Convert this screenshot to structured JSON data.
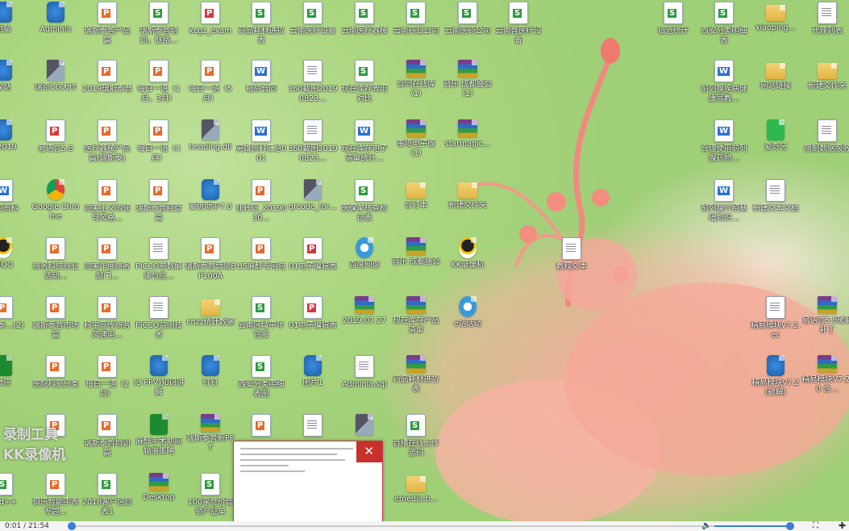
{
  "icons": [
    {
      "id": "i1",
      "type": "app",
      "label": "电脑",
      "col": 0,
      "row": 0
    },
    {
      "id": "i2",
      "type": "app",
      "label": "Adminla",
      "col": 1,
      "row": 0
    },
    {
      "id": "i3",
      "type": "ppt",
      "label": "瑞斯泰普产品篇",
      "col": 2,
      "row": 0
    },
    {
      "id": "i4",
      "type": "xls",
      "label": "瑞斯泰普培训，联络…",
      "col": 3,
      "row": 0
    },
    {
      "id": "i5",
      "type": "pdf",
      "label": "kcgz_exam",
      "col": 4,
      "row": 0
    },
    {
      "id": "i6",
      "type": "xls",
      "label": "药品耗材进货表",
      "col": 5,
      "row": 0
    },
    {
      "id": "i7",
      "type": "xls",
      "label": "云南医疗设备",
      "col": 6,
      "row": 0
    },
    {
      "id": "i8",
      "type": "xls",
      "label": "云南医疗器械",
      "col": 7,
      "row": 0
    },
    {
      "id": "i9",
      "type": "xls",
      "label": "云南药业公司",
      "col": 8,
      "row": 0
    },
    {
      "id": "i10",
      "type": "xls",
      "label": "云南医药公司",
      "col": 9,
      "row": 0
    },
    {
      "id": "i11",
      "type": "xls",
      "label": "云南普医疗设备",
      "col": 10,
      "row": 0
    },
    {
      "id": "i12",
      "type": "xls",
      "label": "临沧统计",
      "col": 13,
      "row": 0
    },
    {
      "id": "i13",
      "type": "xls",
      "label": "西安分类明细表",
      "col": 14,
      "row": 0
    },
    {
      "id": "i14",
      "type": "folder",
      "label": "xiaoping…",
      "col": 15,
      "row": 0
    },
    {
      "id": "i15",
      "type": "txt",
      "label": "代理列表",
      "col": 16,
      "row": 0
    },
    {
      "id": "i16",
      "type": "app",
      "label": "收站",
      "col": 0,
      "row": 1
    },
    {
      "id": "i17",
      "type": "img",
      "label": "瑞奇CG大作",
      "col": 1,
      "row": 1
    },
    {
      "id": "i18",
      "type": "ppt",
      "label": "2019瑞斯泰普",
      "col": 2,
      "row": 1
    },
    {
      "id": "i19",
      "type": "ppt",
      "label": "每日一语（1月，3月）",
      "col": 3,
      "row": 1
    },
    {
      "id": "i20",
      "type": "ppt",
      "label": "每日一语（5月）",
      "col": 4,
      "row": 1
    },
    {
      "id": "i21",
      "type": "doc",
      "label": "租房合同",
      "col": 5,
      "row": 1
    },
    {
      "id": "i22",
      "type": "txt",
      "label": "360截图20190823…",
      "col": 6,
      "row": 1
    },
    {
      "id": "i23",
      "type": "xls",
      "label": "现在库存表用对比",
      "col": 7,
      "row": 1
    },
    {
      "id": "i24",
      "type": "rar",
      "label": "合同在线库（1）",
      "col": 8,
      "row": 1
    },
    {
      "id": "i25",
      "type": "rar",
      "label": "音乐 成都盛会（1）",
      "col": 9,
      "row": 1
    },
    {
      "id": "i26",
      "type": "doc",
      "label": "前列腺疾病健康宣教…",
      "col": 14,
      "row": 1
    },
    {
      "id": "i27",
      "type": "folder",
      "label": "网站链接",
      "col": 15,
      "row": 1
    },
    {
      "id": "i28",
      "type": "folder",
      "label": "新建文件夹",
      "col": 16,
      "row": 1
    },
    {
      "id": "i29",
      "type": "app",
      "label": "S 2019",
      "col": 0,
      "row": 2
    },
    {
      "id": "i30",
      "type": "pdf",
      "label": "易语言5.8",
      "col": 1,
      "row": 2
    },
    {
      "id": "i31",
      "type": "ppt",
      "label": "医疗器械产品篇(瑞斯泰)",
      "col": 2,
      "row": 2
    },
    {
      "id": "i32",
      "type": "ppt",
      "label": "每日一语（4月）",
      "col": 3,
      "row": 2
    },
    {
      "id": "i33",
      "type": "img",
      "label": "heading.dll",
      "col": 4,
      "row": 2
    },
    {
      "id": "i34",
      "type": "doc",
      "label": "英雄资料汇总001",
      "col": 5,
      "row": 2
    },
    {
      "id": "i35",
      "type": "txt",
      "label": "360截图20190823…",
      "col": 6,
      "row": 2
    },
    {
      "id": "i36",
      "type": "doc",
      "label": "现在库存电子清单统计…",
      "col": 7,
      "row": 2
    },
    {
      "id": "i37",
      "type": "rar",
      "label": "事项电子版（1）",
      "col": 8,
      "row": 2
    },
    {
      "id": "i38",
      "type": "rar",
      "label": "starmagic…",
      "col": 9,
      "row": 2
    },
    {
      "id": "i39",
      "type": "doc",
      "label": "合理使用前列腺药物…",
      "col": 14,
      "row": 2
    },
    {
      "id": "i40",
      "type": "iqiyi",
      "label": "爱奇艺",
      "col": 15,
      "row": 2
    },
    {
      "id": "i41",
      "type": "txt",
      "label": "限制数据服务",
      "col": 16,
      "row": 2
    },
    {
      "id": "i42",
      "type": "doc",
      "label": "学习资料",
      "col": 0,
      "row": 3
    },
    {
      "id": "i43",
      "type": "chrome",
      "label": "Google Chrome",
      "col": 1,
      "row": 3
    },
    {
      "id": "i44",
      "type": "ppt",
      "label": "完美主义的领导风格…",
      "col": 2,
      "row": 3
    },
    {
      "id": "i45",
      "type": "ppt",
      "label": "瑞斯泰普经营篇",
      "col": 3,
      "row": 3
    },
    {
      "id": "i46",
      "type": "app",
      "label": "爱思助手7.0",
      "col": 4,
      "row": 3
    },
    {
      "id": "i47",
      "type": "ppt",
      "label": "住转证_2019030…",
      "col": 5,
      "row": 3
    },
    {
      "id": "i48",
      "type": "img",
      "label": "qrcode_for…",
      "col": 6,
      "row": 3
    },
    {
      "id": "i49",
      "type": "xls",
      "label": "医保单核查检证表",
      "col": 7,
      "row": 3
    },
    {
      "id": "i50",
      "type": "folder",
      "label": "合订本",
      "col": 8,
      "row": 3
    },
    {
      "id": "i51",
      "type": "folder",
      "label": "新建文件夹",
      "col": 9,
      "row": 3
    },
    {
      "id": "i52",
      "type": "doc",
      "label": "前列腺介绍基础知识…",
      "col": 14,
      "row": 3
    },
    {
      "id": "i53",
      "type": "txt",
      "label": "新建文本文档",
      "col": 15,
      "row": 3
    },
    {
      "id": "i54",
      "type": "qq",
      "label": "讯QQ",
      "col": 0,
      "row": 4
    },
    {
      "id": "i55",
      "type": "ppt",
      "label": "商务科技商业活动…",
      "col": 1,
      "row": 4
    },
    {
      "id": "i56",
      "type": "ppt",
      "label": "完美年度商务部门…",
      "col": 2,
      "row": 4
    },
    {
      "id": "i57",
      "type": "txt",
      "label": "PICCO参数解读与应…",
      "col": 3,
      "row": 4
    },
    {
      "id": "i58",
      "type": "ppt",
      "label": "瑞斯泰普营销BP100A",
      "col": 4,
      "row": 4
    },
    {
      "id": "i59",
      "type": "ppt",
      "label": "U5麻醉专用包",
      "col": 5,
      "row": 4
    },
    {
      "id": "i60",
      "type": "pdf",
      "label": "01电子编辑表",
      "col": 6,
      "row": 4
    },
    {
      "id": "i61",
      "type": "web",
      "label": "百度网盘",
      "col": 7,
      "row": 4
    },
    {
      "id": "i62",
      "type": "rar",
      "label": "音乐 成都盛会",
      "col": 8,
      "row": 4
    },
    {
      "id": "i63",
      "type": "qq",
      "label": "KK录像机",
      "col": 9,
      "row": 4
    },
    {
      "id": "i64",
      "type": "ppt",
      "label": "瑞斯泰…(2)",
      "col": 0,
      "row": 5
    },
    {
      "id": "i65",
      "type": "ppt",
      "label": "瑞斯泰普市场篇",
      "col": 1,
      "row": 5
    },
    {
      "id": "i66",
      "type": "ppt",
      "label": "穆宝蕊传商务风通用…",
      "col": 2,
      "row": 5
    },
    {
      "id": "i67",
      "type": "txt",
      "label": "PICCO监测技术",
      "col": 3,
      "row": 5
    },
    {
      "id": "i68",
      "type": "folder",
      "label": "cnzz统计数据",
      "col": 4,
      "row": 5
    },
    {
      "id": "i69",
      "type": "xls",
      "label": "云南区域平年官报",
      "col": 5,
      "row": 5
    },
    {
      "id": "i70",
      "type": "pdf",
      "label": "01电子编辑表",
      "col": 6,
      "row": 5
    },
    {
      "id": "i71",
      "type": "rar",
      "label": "2019.07.27",
      "col": 7,
      "row": 5
    },
    {
      "id": "i72",
      "type": "rar",
      "label": "现在库存产品清单",
      "col": 8,
      "row": 5
    },
    {
      "id": "i73",
      "type": "web",
      "label": "e站活动",
      "col": 9,
      "row": 5
    },
    {
      "id": "i74",
      "type": "txt",
      "label": "精易模块v7.2.ec",
      "col": 15,
      "row": 5
    },
    {
      "id": "i75",
      "type": "rar",
      "label": "易语言5.8破解补丁",
      "col": 16,
      "row": 5
    },
    {
      "id": "i76",
      "type": "green",
      "label": "微信",
      "col": 0,
      "row": 6
    },
    {
      "id": "i77",
      "type": "ppt",
      "label": "医院科室分类",
      "col": 1,
      "row": 6
    },
    {
      "id": "i78",
      "type": "ppt",
      "label": "每日一语（2月）",
      "col": 2,
      "row": 6
    },
    {
      "id": "i79",
      "type": "app",
      "label": "(3 PPV)知识讲解",
      "col": 3,
      "row": 6
    },
    {
      "id": "i80",
      "type": "app",
      "label": "钉钉",
      "col": 4,
      "row": 6
    },
    {
      "id": "i81",
      "type": "xls",
      "label": "西安分类明细表图",
      "col": 5,
      "row": 6
    },
    {
      "id": "i82",
      "type": "app",
      "label": "图片1",
      "col": 6,
      "row": 6
    },
    {
      "id": "i83",
      "type": "txt",
      "label": "Adminla.sql",
      "col": 7,
      "row": 6
    },
    {
      "id": "i84",
      "type": "rar",
      "label": "药品耗材进货表",
      "col": 8,
      "row": 6
    },
    {
      "id": "i85",
      "type": "app",
      "label": "精易模块v7.2(破解)",
      "col": 15,
      "row": 6
    },
    {
      "id": "i86",
      "type": "rar",
      "label": "精易模块V7.2.0 含…",
      "col": 16,
      "row": 6
    },
    {
      "id": "i87",
      "type": "ppt",
      "label": "",
      "col": 1,
      "row": 7
    },
    {
      "id": "i88",
      "type": "ppt",
      "label": "瑞斯泰普培训篇",
      "col": 2,
      "row": 7
    },
    {
      "id": "i89",
      "type": "green",
      "label": "麻醉手术期间输液策略",
      "col": 3,
      "row": 7
    },
    {
      "id": "i90",
      "type": "rar",
      "label": "瑞斯泰普新PPT",
      "col": 4,
      "row": 7
    },
    {
      "id": "i91",
      "type": "ppt",
      "label": "",
      "col": 5,
      "row": 7
    },
    {
      "id": "i92",
      "type": "txt",
      "label": "",
      "col": 6,
      "row": 7
    },
    {
      "id": "i93",
      "type": "img",
      "label": "",
      "col": 7,
      "row": 7
    },
    {
      "id": "i94",
      "type": "xls",
      "label": "直播在线上传源码",
      "col": 8,
      "row": 7
    },
    {
      "id": "i95",
      "type": "xls",
      "label": "pad++",
      "col": 0,
      "row": 8
    },
    {
      "id": "i96",
      "type": "ppt",
      "label": "俱乐智能手表专题…",
      "col": 1,
      "row": 8
    },
    {
      "id": "i97",
      "type": "xls",
      "label": "2018客户信息表1",
      "col": 2,
      "row": 8
    },
    {
      "id": "i98",
      "type": "rar",
      "label": "Desktop",
      "col": 3,
      "row": 8
    },
    {
      "id": "i99",
      "type": "xls",
      "label": "100家竞价营销产品单",
      "col": 4,
      "row": 8
    },
    {
      "id": "i100",
      "type": "folder",
      "label": "emedia.b…",
      "col": 8,
      "row": 8
    }
  ],
  "floating_file": {
    "label": "教程文本"
  },
  "popup": {
    "close": "✕"
  },
  "watermark": {
    "line1": "录制工具",
    "line2": "KK录像机"
  },
  "player": {
    "time": "0:01 / 21:54",
    "progress_fraction": 0.003,
    "volume_icon": "🔈",
    "fullscreen_icon": "⛶",
    "plus_icon": "✚"
  }
}
